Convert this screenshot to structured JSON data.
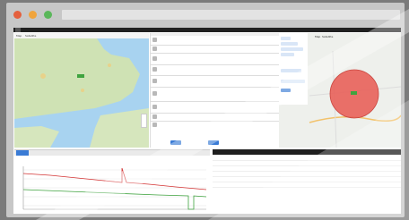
{
  "window": {
    "dots": {
      "close": "#e4603d",
      "minimize": "#f0a43c",
      "maximize": "#5ab75a"
    }
  },
  "toolbar": {
    "items": [
      "",
      "",
      ""
    ]
  },
  "map_left": {
    "tabs": [
      "Map",
      "Satellite"
    ]
  },
  "detail": {
    "rows": [
      {
        "label": "",
        "value": ""
      },
      {
        "label": "",
        "value": ""
      },
      {
        "label": "",
        "value": ""
      },
      {
        "label": "",
        "value": ""
      },
      {
        "label": "",
        "value": ""
      },
      {
        "label": "",
        "value": ""
      },
      {
        "label": "",
        "value": ""
      },
      {
        "label": "",
        "value": ""
      },
      {
        "label": "",
        "value": ""
      }
    ],
    "buttons": [
      "",
      ""
    ]
  },
  "map_right": {
    "tabs": [
      "Map",
      "Satellite"
    ],
    "side_items": [
      "",
      "",
      "",
      "",
      "",
      "",
      ""
    ]
  },
  "chart": {
    "tabs": [
      "",
      "",
      "",
      "",
      "",
      "",
      "",
      ""
    ],
    "title": ""
  },
  "table": {
    "headers": [
      "",
      "",
      "",
      "",
      ""
    ],
    "rows": [
      [
        "",
        "",
        "",
        "",
        ""
      ],
      [
        "",
        "",
        "",
        "",
        ""
      ],
      [
        "",
        "",
        "",
        "",
        ""
      ],
      [
        "",
        "",
        "",
        "",
        ""
      ],
      [
        "",
        "",
        "",
        "",
        ""
      ],
      [
        "",
        "",
        "",
        "",
        ""
      ]
    ]
  },
  "colors": {
    "accent": "#3a7bd5",
    "zone_fill": "#e8605a",
    "chart_red": "#d33333",
    "chart_green": "#3fa33f",
    "land_green": "#cfe2b4",
    "sea_blue": "#a8d3f0"
  }
}
